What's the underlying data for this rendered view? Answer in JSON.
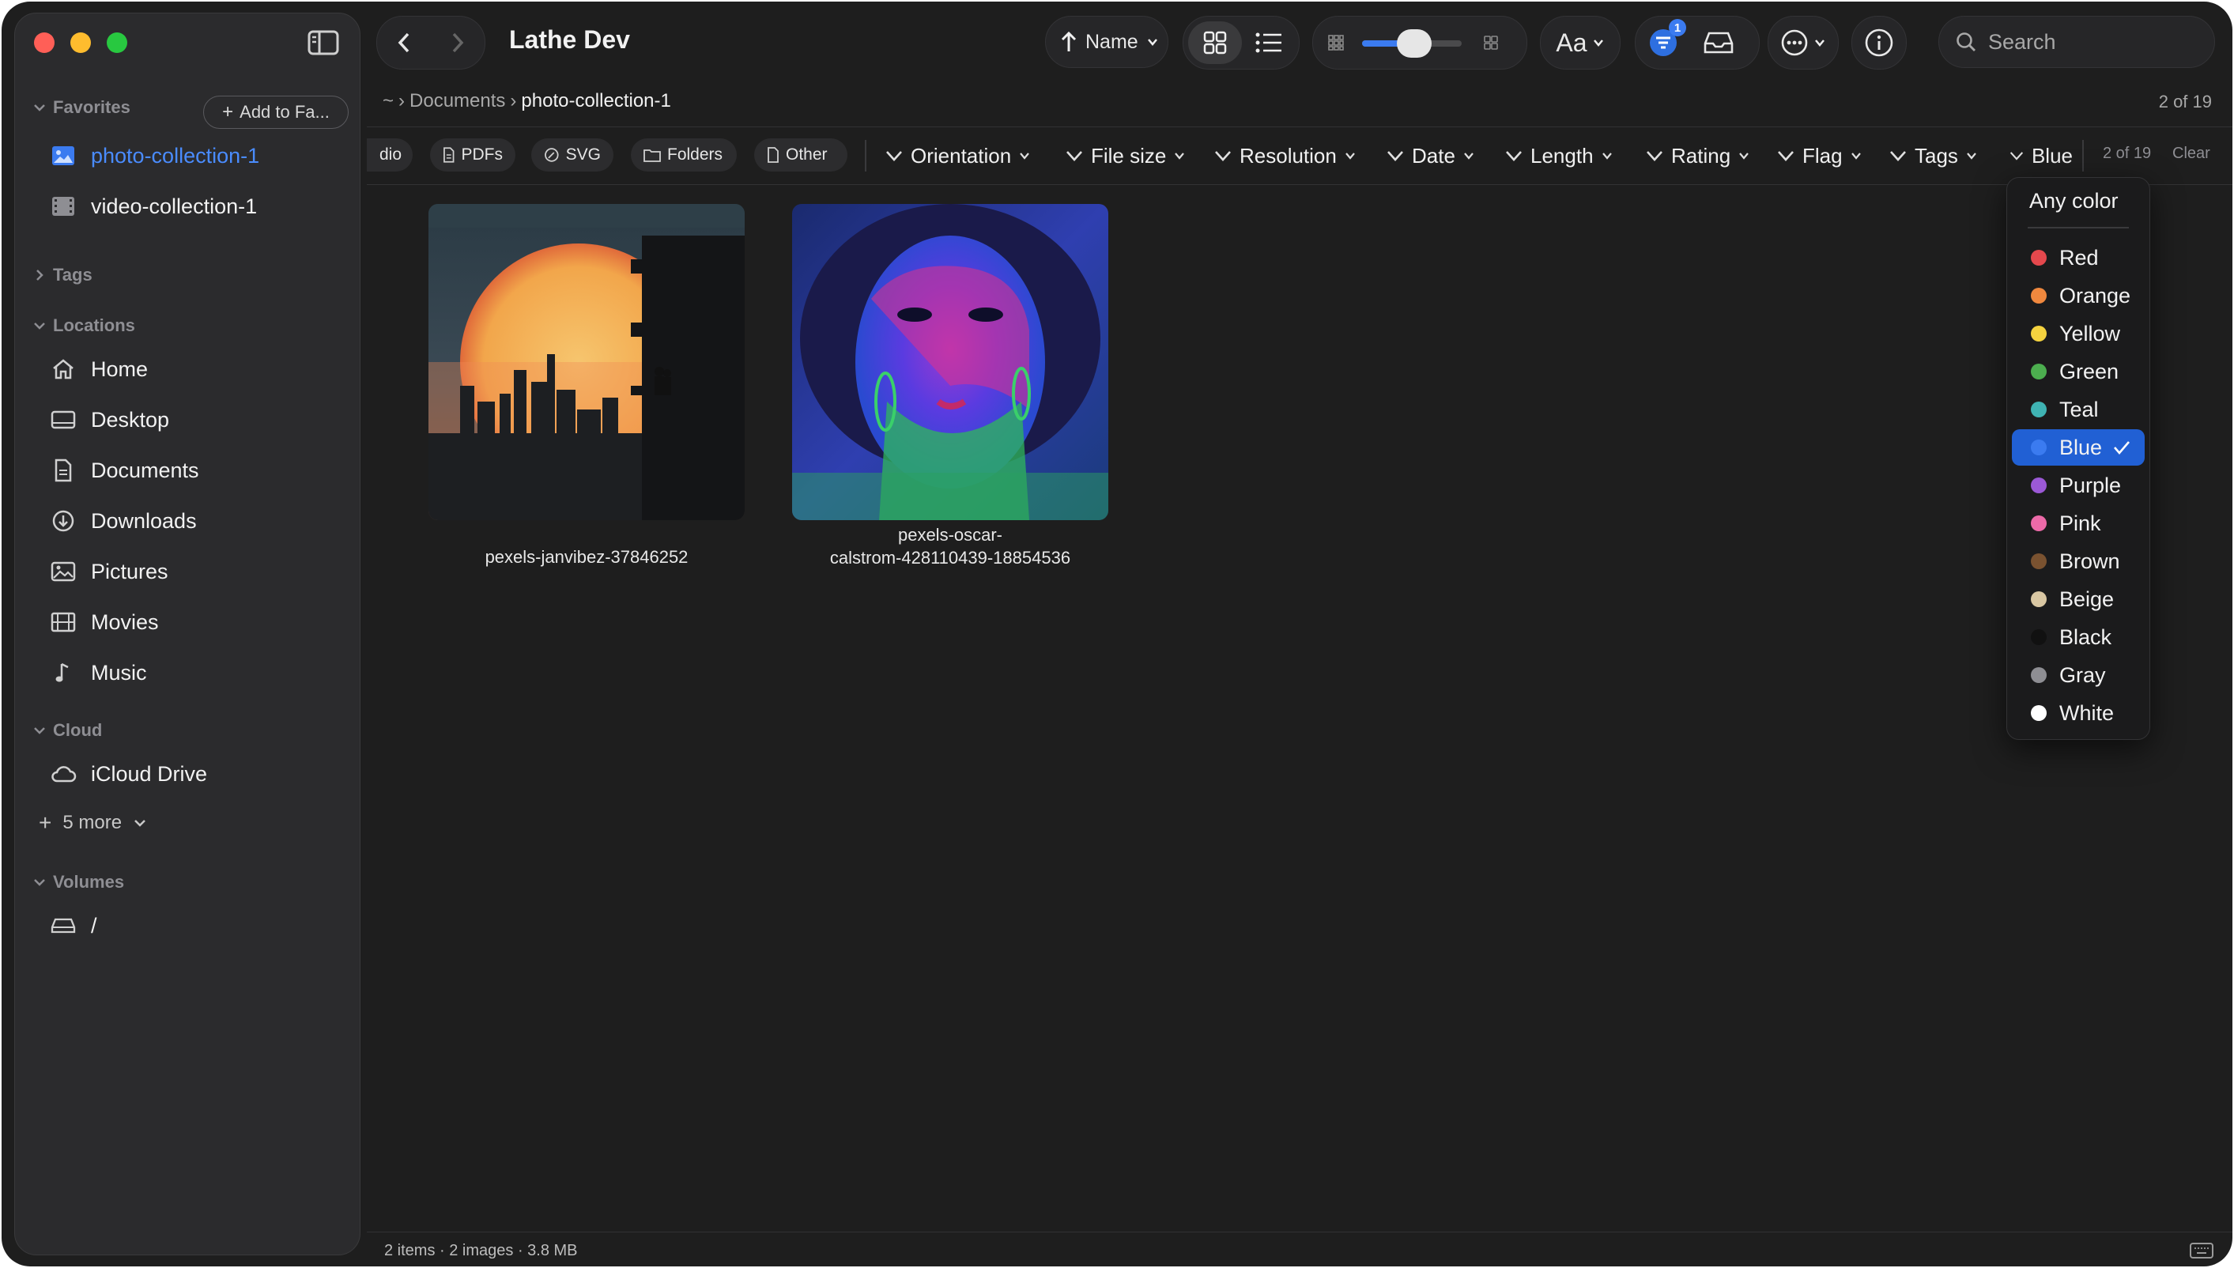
{
  "window": {
    "title": "Lathe Dev"
  },
  "sidebar": {
    "add_favorite_label": "Add to Fa...",
    "sections": {
      "favorites": "Favorites",
      "tags": "Tags",
      "locations": "Locations",
      "cloud": "Cloud",
      "volumes": "Volumes"
    },
    "favorites": [
      {
        "label": "photo-collection-1",
        "icon": "photo-folder-icon"
      },
      {
        "label": "video-collection-1",
        "icon": "film-folder-icon"
      }
    ],
    "locations": [
      {
        "label": "Home",
        "icon": "house-icon"
      },
      {
        "label": "Desktop",
        "icon": "desktop-icon"
      },
      {
        "label": "Documents",
        "icon": "document-icon"
      },
      {
        "label": "Downloads",
        "icon": "download-icon"
      },
      {
        "label": "Pictures",
        "icon": "picture-icon"
      },
      {
        "label": "Movies",
        "icon": "film-icon"
      },
      {
        "label": "Music",
        "icon": "music-note-icon"
      }
    ],
    "cloud": [
      {
        "label": "iCloud Drive",
        "icon": "cloud-icon"
      }
    ],
    "more_label": "5 more",
    "volumes": [
      {
        "label": "/",
        "icon": "drive-icon"
      }
    ]
  },
  "toolbar": {
    "sort_label": "Name",
    "font_label": "Aa",
    "filter_badge": "1",
    "search_placeholder": "Search"
  },
  "breadcrumb": {
    "root": "~",
    "parent": "Documents",
    "current": "photo-collection-1",
    "count": "2 of 19"
  },
  "filters": {
    "chips": [
      "dio",
      "PDFs",
      "SVG",
      "Folders",
      "Other"
    ],
    "dropdowns": [
      "Orientation",
      "File size",
      "Resolution",
      "Date",
      "Length",
      "Rating",
      "Flag",
      "Tags",
      "Blue"
    ],
    "count": "2 of 19",
    "clear_label": "Clear"
  },
  "files": [
    {
      "name": "pexels-janvibez-37846252"
    },
    {
      "name_line1": "pexels-oscar-",
      "name_line2": "calstrom-428110439-18854536"
    }
  ],
  "color_menu": {
    "any_label": "Any color",
    "selected": "Blue",
    "items": [
      {
        "label": "Red",
        "color": "#e5484d"
      },
      {
        "label": "Orange",
        "color": "#f0883e"
      },
      {
        "label": "Yellow",
        "color": "#f5d33f"
      },
      {
        "label": "Green",
        "color": "#4cae4f"
      },
      {
        "label": "Teal",
        "color": "#3fb3b3"
      },
      {
        "label": "Blue",
        "color": "#3b7bf0"
      },
      {
        "label": "Purple",
        "color": "#9b59d6"
      },
      {
        "label": "Pink",
        "color": "#ec6aa8"
      },
      {
        "label": "Brown",
        "color": "#7a5230"
      },
      {
        "label": "Beige",
        "color": "#d9c7a3"
      },
      {
        "label": "Black",
        "color": "#111111"
      },
      {
        "label": "Gray",
        "color": "#8e8e93"
      },
      {
        "label": "White",
        "color": "#ffffff"
      }
    ]
  },
  "status": {
    "text": "2 items · 2 images · 3.8 MB"
  },
  "colors": {
    "accent": "#3b82f6",
    "background": "#1e1e1e",
    "sidebar": "#2b2b2d"
  }
}
